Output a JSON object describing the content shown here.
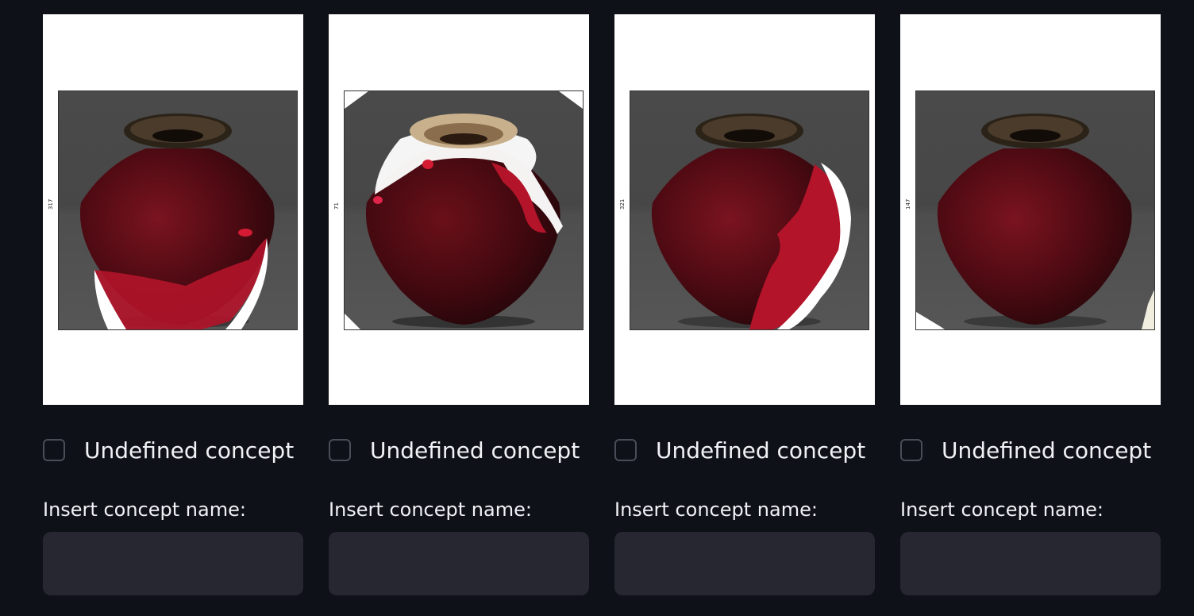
{
  "cards": [
    {
      "axis_label": "317",
      "checkbox_label": "Undefined concept",
      "input_label": "Insert concept name:",
      "input_value": ""
    },
    {
      "axis_label": "71",
      "checkbox_label": "Undefined concept",
      "input_label": "Insert concept name:",
      "input_value": ""
    },
    {
      "axis_label": "321",
      "checkbox_label": "Undefined concept",
      "input_label": "Insert concept name:",
      "input_value": ""
    },
    {
      "axis_label": "147",
      "checkbox_label": "Undefined concept",
      "input_label": "Insert concept name:",
      "input_value": ""
    }
  ],
  "colors": {
    "background": "#0e1117",
    "input_background": "#262730",
    "vase_dark_red": "#5a0a12",
    "highlight_red": "#c8142a"
  }
}
